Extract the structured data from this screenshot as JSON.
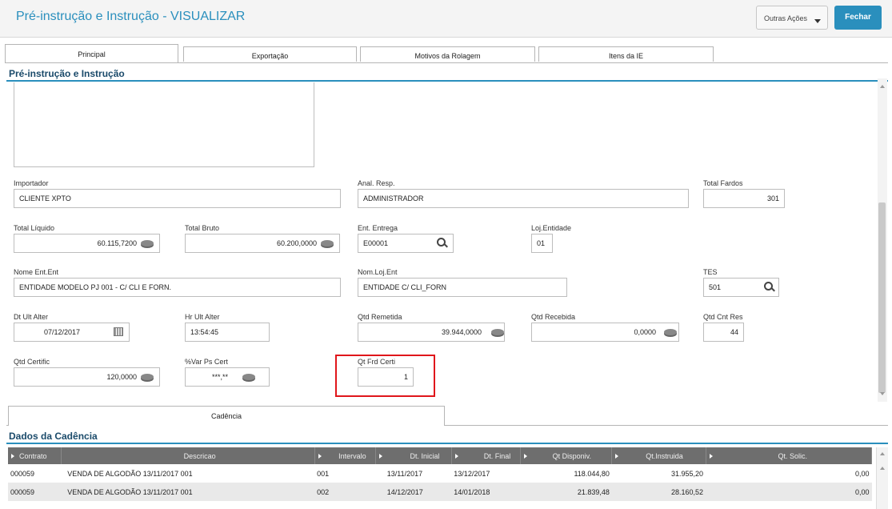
{
  "header": {
    "title": "Pré-instrução e Instrução - VISUALIZAR",
    "outras_acoes": "Outras Ações",
    "fechar": "Fechar"
  },
  "tabs": [
    "Principal",
    "Exportação",
    "Motivos da Rolagem",
    "Itens da IE"
  ],
  "section_title": "Pré-instrução e Instrução",
  "form": {
    "importador": {
      "label": "Importador",
      "value": "CLIENTE XPTO"
    },
    "anal_resp": {
      "label": "Anal. Resp.",
      "value": "ADMINISTRADOR"
    },
    "total_fardos": {
      "label": "Total Fardos",
      "value": "301"
    },
    "total_liquido": {
      "label": "Total Líquido",
      "value": "60.115,7200"
    },
    "total_bruto": {
      "label": "Total Bruto",
      "value": "60.200,0000"
    },
    "ent_entrega": {
      "label": "Ent. Entrega",
      "value": "E00001"
    },
    "loj_entidade": {
      "label": "Loj.Entidade",
      "value": "01"
    },
    "nome_ent_ent": {
      "label": "Nome Ent.Ent",
      "value": "ENTIDADE MODELO PJ 001 - C/ CLI E FORN."
    },
    "nom_loj_ent": {
      "label": "Nom.Loj.Ent",
      "value": "ENTIDADE C/ CLI_FORN"
    },
    "tes": {
      "label": "TES",
      "value": "501"
    },
    "dt_ult_alter": {
      "label": "Dt Ult Alter",
      "value": "07/12/2017"
    },
    "hr_ult_alter": {
      "label": "Hr Ult Alter",
      "value": "13:54:45"
    },
    "qtd_remetida": {
      "label": "Qtd Remetida",
      "value": "39.944,0000"
    },
    "qtd_recebida": {
      "label": "Qtd Recebida",
      "value": "0,0000"
    },
    "qtd_cnt_res": {
      "label": "Qtd Cnt Res",
      "value": "44"
    },
    "qtd_certific": {
      "label": "Qtd Certific",
      "value": "120,0000"
    },
    "var_ps_cert": {
      "label": "%Var Ps Cert",
      "value": "***,**"
    },
    "qt_frd_certi": {
      "label": "Qt Frd Certi",
      "value": "1"
    }
  },
  "cadencia_tab": "Cadência",
  "dados_title": "Dados da Cadência",
  "grid": {
    "columns": [
      "Contrato",
      "Descricao",
      "Intervalo",
      "Dt. Inicial",
      "Dt. Final",
      "Qt Disponiv.",
      "Qt.Instruida",
      "Qt. Solic."
    ],
    "rows": [
      [
        "000059",
        "VENDA DE ALGODÃO 13/11/2017 001",
        "001",
        "13/11/2017",
        "13/12/2017",
        "118.044,80",
        "31.955,20",
        "0,00"
      ],
      [
        "000059",
        "VENDA DE ALGODÃO 13/11/2017 001",
        "002",
        "14/12/2017",
        "14/01/2018",
        "21.839,48",
        "28.160,52",
        "0,00"
      ]
    ]
  },
  "colors": {
    "accent": "#2a8fbd",
    "highlight": "#e0161b",
    "grid_header": "#6e6e6e"
  }
}
